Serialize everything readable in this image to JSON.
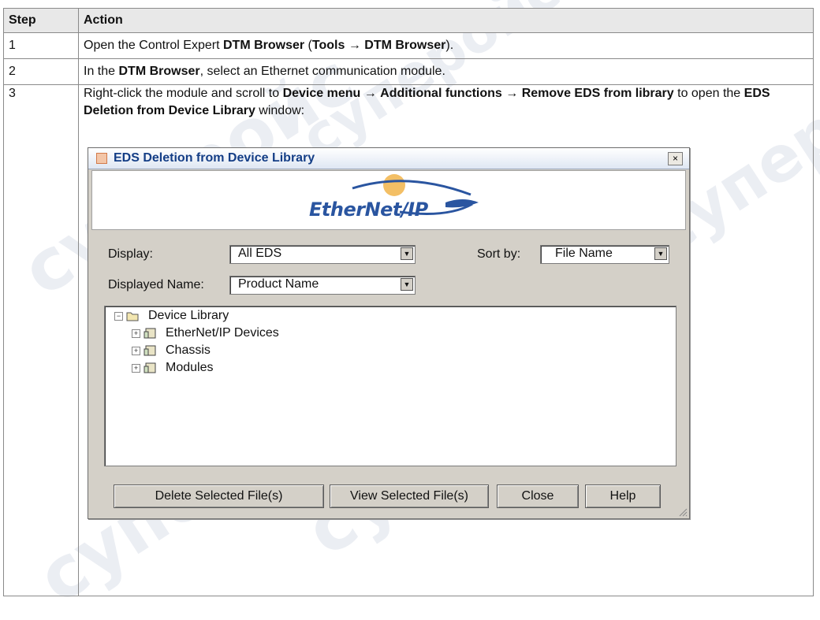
{
  "table": {
    "headers": [
      "Step",
      "Action"
    ],
    "rows": [
      {
        "step": "1",
        "text": [
          "Open the Control Expert ",
          "DTM Browser",
          " (",
          "Tools",
          " → ",
          "DTM Browser",
          ")."
        ]
      },
      {
        "step": "2",
        "text": [
          "In the ",
          "DTM Browser",
          ", select an Ethernet communication module."
        ]
      },
      {
        "step": "3",
        "text": [
          "Right-click the module and scroll to ",
          "Device menu",
          " → ",
          "Additional functions",
          " → ",
          "Remove EDS from library",
          " to open the ",
          "EDS Deletion from Device Library",
          " window:"
        ]
      }
    ]
  },
  "dialog": {
    "title": "EDS Deletion from Device Library",
    "close_glyph": "×",
    "logo_text": "EtherNet/IP",
    "display_label": "Display:",
    "display_value": "All EDS",
    "sortby_label": "Sort by:",
    "sortby_value": "File Name",
    "displayed_name_label": "Displayed Name:",
    "displayed_name_value": "Product Name",
    "tree": {
      "root": "Device Library",
      "children": [
        "EtherNet/IP Devices",
        "Chassis",
        "Modules"
      ]
    },
    "buttons": {
      "delete": "Delete Selected File(s)",
      "view": "View Selected File(s)",
      "close": "Close",
      "help": "Help"
    }
  },
  "watermark": "cyпepoйc",
  "colors": {
    "title_text": "#143e86",
    "logo": "#2a55a0",
    "header_bg": "#e8e8e8",
    "dialog_bg": "#d4d0c8"
  }
}
